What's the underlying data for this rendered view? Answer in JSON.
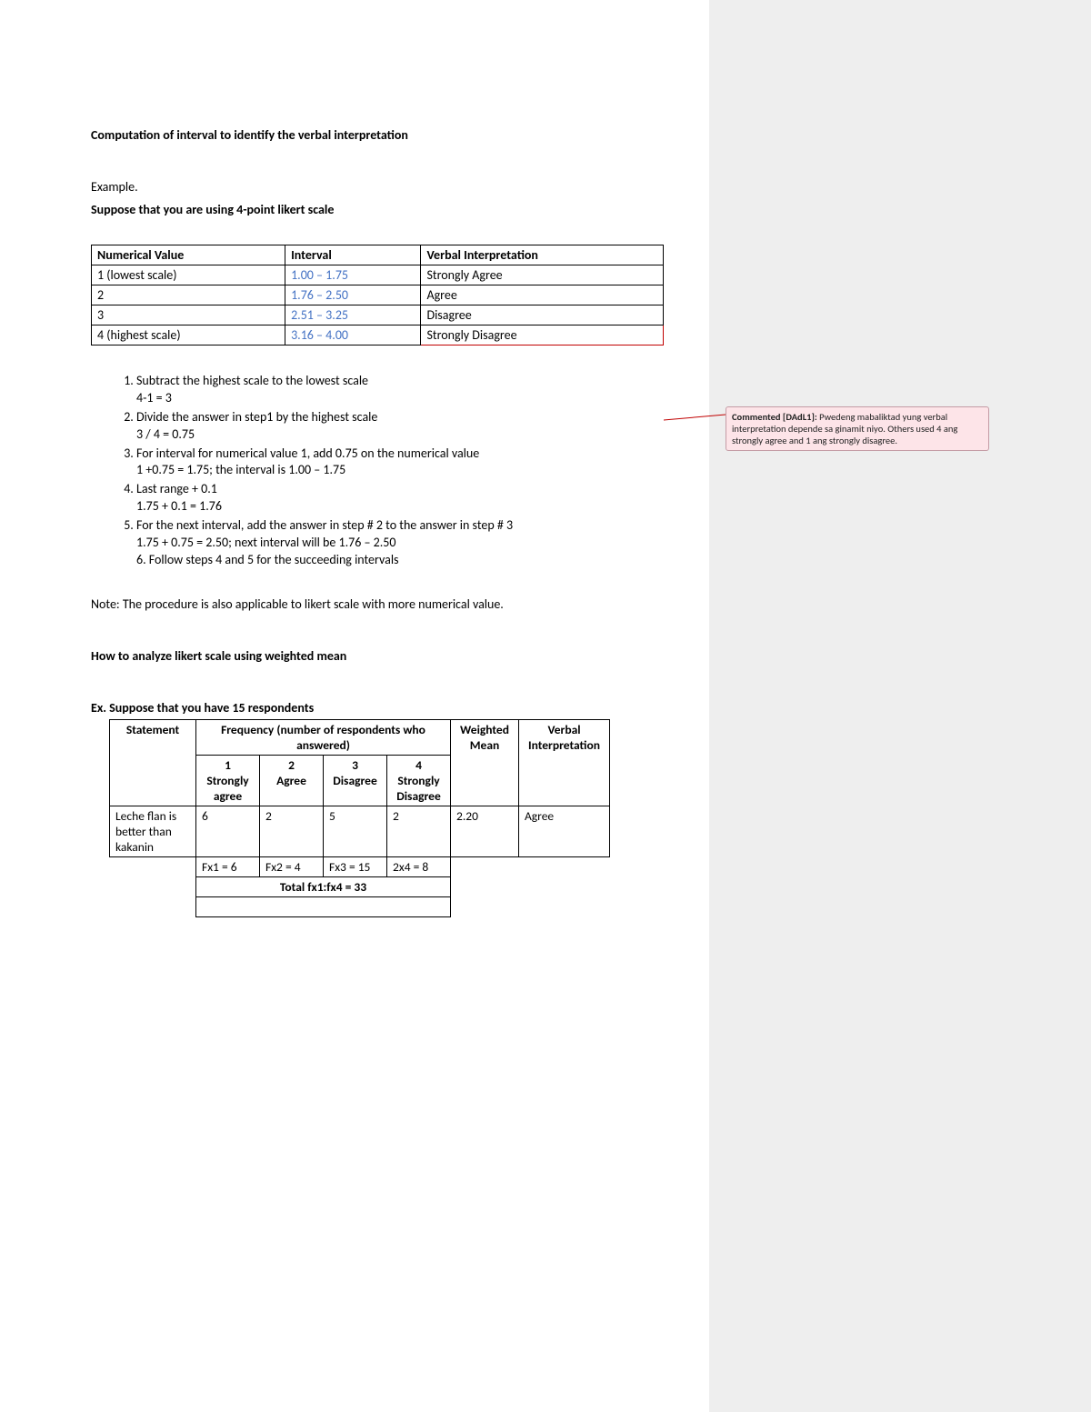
{
  "title": "Computation of interval to identify the verbal interpretation",
  "example_label": "Example.",
  "suppose": "Suppose that you are using 4-point likert scale",
  "t1": {
    "h1": "Numerical Value",
    "h2": "Interval",
    "h3": "Verbal Interpretation",
    "rows": [
      {
        "nv": "1 (lowest scale)",
        "int": "1.00 – 1.75",
        "vi": "Strongly Agree"
      },
      {
        "nv": "2",
        "int": "1.76 – 2.50",
        "vi": "Agree"
      },
      {
        "nv": "3",
        "int": "2.51 – 3.25",
        "vi": "Disagree"
      },
      {
        "nv": "4 (highest scale)",
        "int": "3.16 – 4.00",
        "vi": "Strongly Disagree"
      }
    ]
  },
  "steps": {
    "s1": "Subtract the highest scale to the lowest scale",
    "s1b": "4-1 = 3",
    "s2": "Divide the answer in step1 by the highest scale",
    "s2b": "3 / 4 = 0.75",
    "s3": "For interval for numerical value 1, add 0.75 on the numerical value",
    "s3b": "1 +0.75 = 1.75; the interval is 1.00 – 1.75",
    "s4": "Last range + 0.1",
    "s4b": "1.75 + 0.1 = 1.76",
    "s5": "For the next interval, add the answer in step # 2 to the answer in step # 3",
    "s5b": "1.75 + 0.75 = 2.50; next interval will be 1.76 – 2.50",
    "s5c": "6. Follow steps 4 and 5 for the succeeding intervals"
  },
  "note": "Note: The procedure is also applicable to likert scale with more numerical value.",
  "how_title": "How to analyze likert scale using weighted mean",
  "ex2": "Ex. Suppose that you have 15 respondents",
  "t2": {
    "h_stmt": "Statement",
    "h_freq": "Frequency (number of respondents who answered)",
    "h_wm": "Weighted Mean",
    "h_vi": "Verbal Interpretation",
    "c1a": "1",
    "c1b": "Strongly agree",
    "c2a": "2",
    "c2b": "Agree",
    "c3a": "3",
    "c3b": "Disagree",
    "c4a": "4",
    "c4b": "Strongly Disagree",
    "stmt": "Leche flan is better than kakanin",
    "v1": "6",
    "v2": "2",
    "v3": "5",
    "v4": "2",
    "wm": "2.20",
    "vi": "Agree",
    "fx1": "Fx1 = 6",
    "fx2": "Fx2 = 4",
    "fx3": "Fx3 = 15",
    "fx4": "2x4 = 8",
    "total": "Total fx1:fx4 = 33"
  },
  "comment": {
    "label": "Commented [DAdL1]: ",
    "text": "Pwedeng mabaliktad yung verbal interpretation depende sa ginamit niyo. Others used 4 ang strongly agree and 1 ang strongly disagree."
  }
}
